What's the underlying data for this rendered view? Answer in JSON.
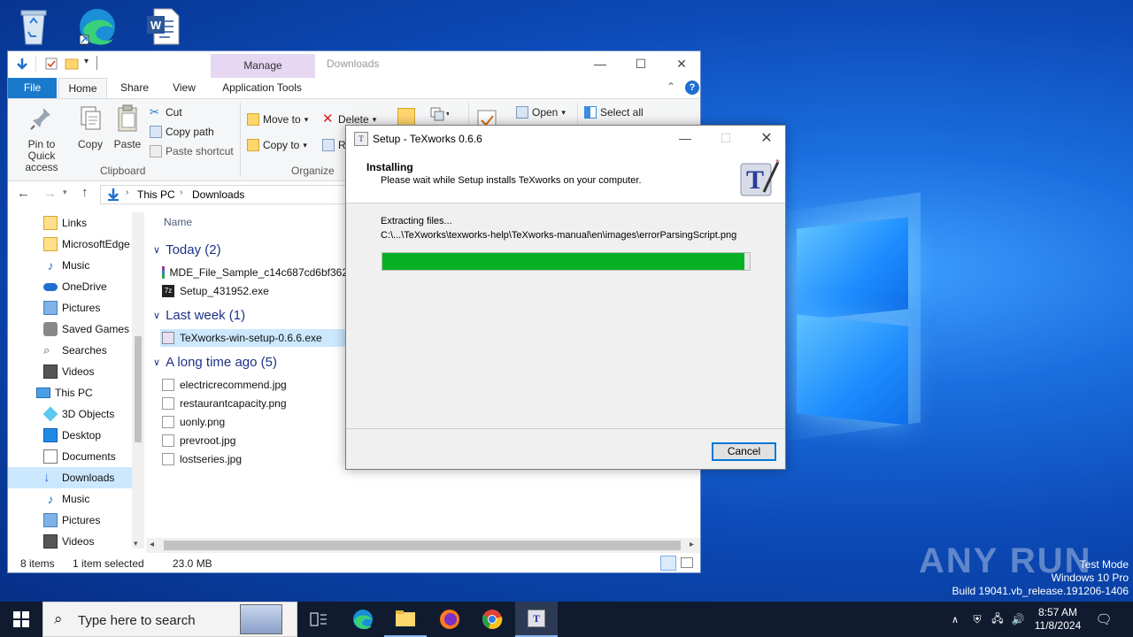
{
  "explorer": {
    "title": "Downloads",
    "manage_tab": "Manage",
    "tabs": [
      "File",
      "Home",
      "Share",
      "View",
      "Application Tools"
    ],
    "ribbon": {
      "pin_label": "Pin to Quick access",
      "copy_label": "Copy",
      "paste_label": "Paste",
      "cut_label": "Cut",
      "copy_path_label": "Copy path",
      "paste_shortcut_label": "Paste shortcut",
      "clipboard_group": "Clipboard",
      "move_to_label": "Move to",
      "copy_to_label": "Copy to",
      "delete_label": "Delete",
      "rename_label": "Re",
      "organize_group": "Organize",
      "open_label": "Open",
      "select_all_label": "Select all"
    },
    "breadcrumb": [
      "This PC",
      "Downloads"
    ],
    "column_name": "Name",
    "nav_items": [
      "Links",
      "MicrosoftEdge",
      "Music",
      "OneDrive",
      "Pictures",
      "Saved Games",
      "Searches",
      "Videos",
      "This PC",
      "3D Objects",
      "Desktop",
      "Documents",
      "Downloads",
      "Music",
      "Pictures",
      "Videos"
    ],
    "groups": [
      {
        "header": "Today (2)",
        "files": [
          "MDE_File_Sample_c14c687cd6bf362",
          "Setup_431952.exe"
        ]
      },
      {
        "header": "Last week (1)",
        "files": [
          "TeXworks-win-setup-0.6.6.exe"
        ]
      },
      {
        "header": "A long time ago (5)",
        "files": [
          "electricrecommend.jpg",
          "restaurantcapacity.png",
          "uonly.png",
          "prevroot.jpg",
          "lostseries.jpg"
        ]
      }
    ],
    "status": {
      "items": "8 items",
      "selected": "1 item selected",
      "size": "23.0 MB"
    }
  },
  "setup": {
    "title": "Setup - TeXworks 0.6.6",
    "heading": "Installing",
    "subheading": "Please wait while Setup installs TeXworks on your computer.",
    "status": "Extracting files...",
    "path": "C:\\...\\TeXworks\\texworks-help\\TeXworks-manual\\en\\images\\errorParsingScript.png",
    "progress": 0.985,
    "cancel_label": "Cancel"
  },
  "taskbar": {
    "search_placeholder": "Type here to search",
    "time": "8:57 AM",
    "date": "11/8/2024"
  },
  "watermark": {
    "brand": "ANY RUN",
    "line1": "Test Mode",
    "line2": "Windows 10 Pro",
    "line3": "Build 19041.vb_release.191206-1406"
  },
  "colors": {
    "accent": "#0078d7",
    "progress": "#06b025",
    "file_tab": "#1979ca",
    "group_header": "#1e3287"
  }
}
